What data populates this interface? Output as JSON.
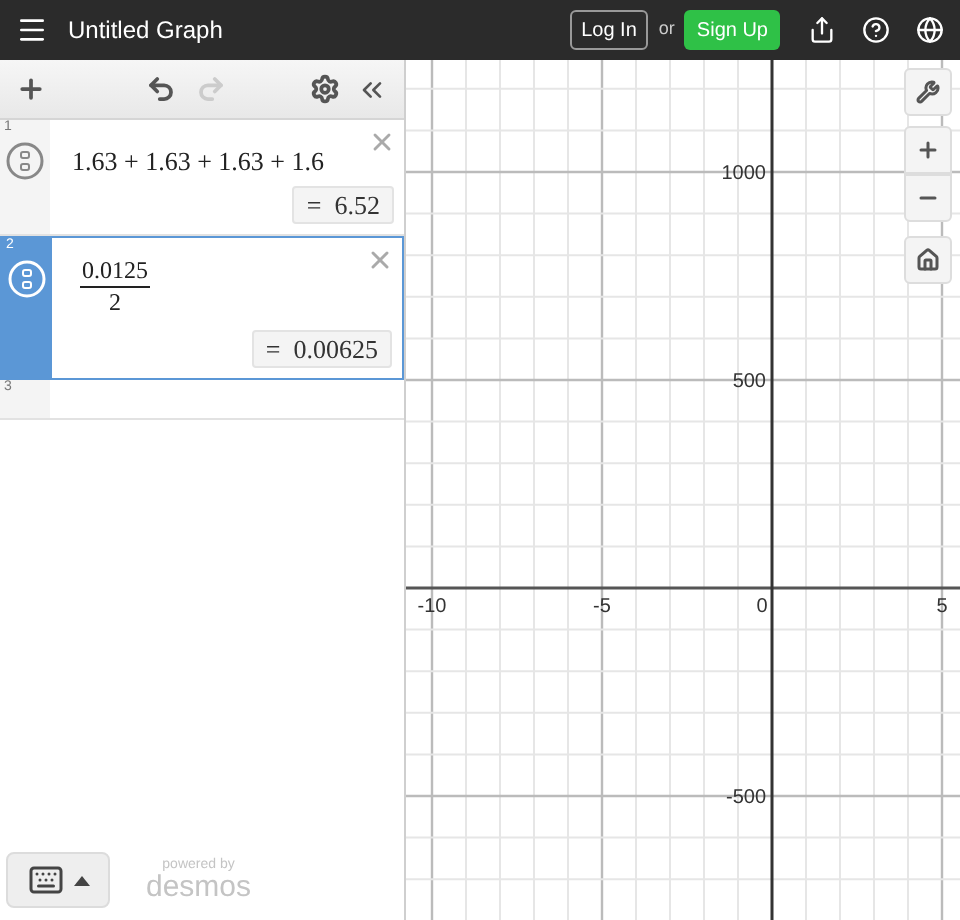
{
  "header": {
    "title": "Untitled Graph",
    "login": "Log In",
    "or": "or",
    "signup": "Sign Up"
  },
  "expressions": [
    {
      "number": "1",
      "kind": "sum",
      "text": "1.63 + 1.63 + 1.63 + 1.6",
      "result": "=  6.52",
      "selected": false
    },
    {
      "number": "2",
      "kind": "fraction",
      "numerator": "0.0125",
      "denominator": "2",
      "result": "=  0.00625",
      "selected": true
    },
    {
      "number": "3",
      "kind": "empty",
      "selected": false
    }
  ],
  "graph": {
    "x_labels": [
      "-10",
      "-5",
      "0",
      "5"
    ],
    "y_labels": [
      "1000",
      "500",
      "-500"
    ]
  },
  "footer": {
    "powered_by": "powered by",
    "brand": "desmos"
  }
}
